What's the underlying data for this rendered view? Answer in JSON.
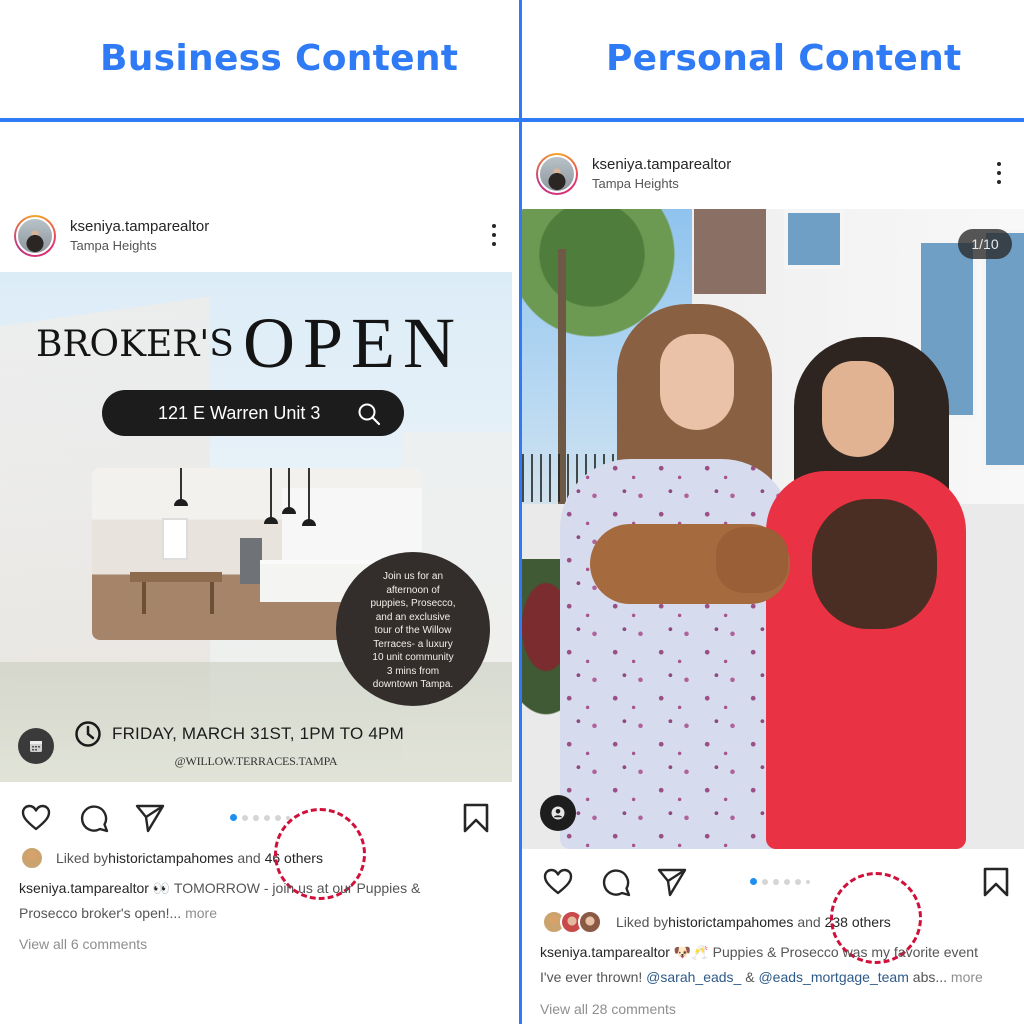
{
  "headers": {
    "left_title": "Business Content",
    "right_title": "Personal Content"
  },
  "colors": {
    "accent_blue": "#2f7bf5",
    "highlight_red": "#d0103a",
    "carousel_active_dot": "#1f8ef1"
  },
  "business_post": {
    "username": "kseniya.tamparealtor",
    "location": "Tampa Heights",
    "menu_icon": "more-vertical-icon",
    "flyer": {
      "title_small": "BROKER'S",
      "title_large": "OPEN",
      "address": "121 E Warren Unit 3",
      "address_icon": "search-icon",
      "bubble_lines": [
        "Join us for an",
        "afternoon of",
        "puppies, Prosecco,",
        "and an exclusive",
        "tour of the Willow",
        "Terraces- a luxury",
        "10 unit community",
        "3 mins from",
        "downtown Tampa."
      ],
      "when": "FRIDAY, MARCH 31ST,  1PM TO 4PM",
      "when_icon": "clock-icon",
      "handle": "@WILLOW.TERRACES.TAMPA",
      "corner_button_icon": "calendar-icon"
    },
    "actions": [
      "heart-icon",
      "comment-icon",
      "share-icon",
      "bookmark-icon"
    ],
    "carousel": {
      "current": 1,
      "visible_dots": 6
    },
    "likes": {
      "prefix": "Liked by ",
      "user": "historictampahomes",
      "middle": " and ",
      "others": "46 others"
    },
    "caption": {
      "username": "kseniya.tamparealtor",
      "emoji": "👀",
      "text_line1": " TOMORROW - join us at our Puppies &",
      "text_line2": "Prosecco broker's open!...",
      "more": " more"
    },
    "comments_link": "View all 6 comments"
  },
  "personal_post": {
    "username": "kseniya.tamparealtor",
    "location": "Tampa Heights",
    "menu_icon": "more-vertical-icon",
    "photo_counter": "1/10",
    "corner_button_icon": "user-tag-icon",
    "actions": [
      "heart-icon",
      "comment-icon",
      "share-icon",
      "bookmark-icon"
    ],
    "carousel": {
      "current": 1,
      "visible_dots": 6
    },
    "likes": {
      "prefix": "Liked by ",
      "user": "historictampahomes",
      "middle": " and ",
      "others": "238 others"
    },
    "caption": {
      "username": "kseniya.tamparealtor",
      "emoji": "🐶🥂",
      "text_line1": " Puppies & Prosecco was my favorite event",
      "text_line2_start": "I've ever thrown! ",
      "mention1": "@sarah_eads_",
      "amp": " & ",
      "mention2": "@eads_mortgage_team",
      "text_line2_end": " abs...",
      "more": " more"
    },
    "comments_link": "View all 28 comments"
  }
}
